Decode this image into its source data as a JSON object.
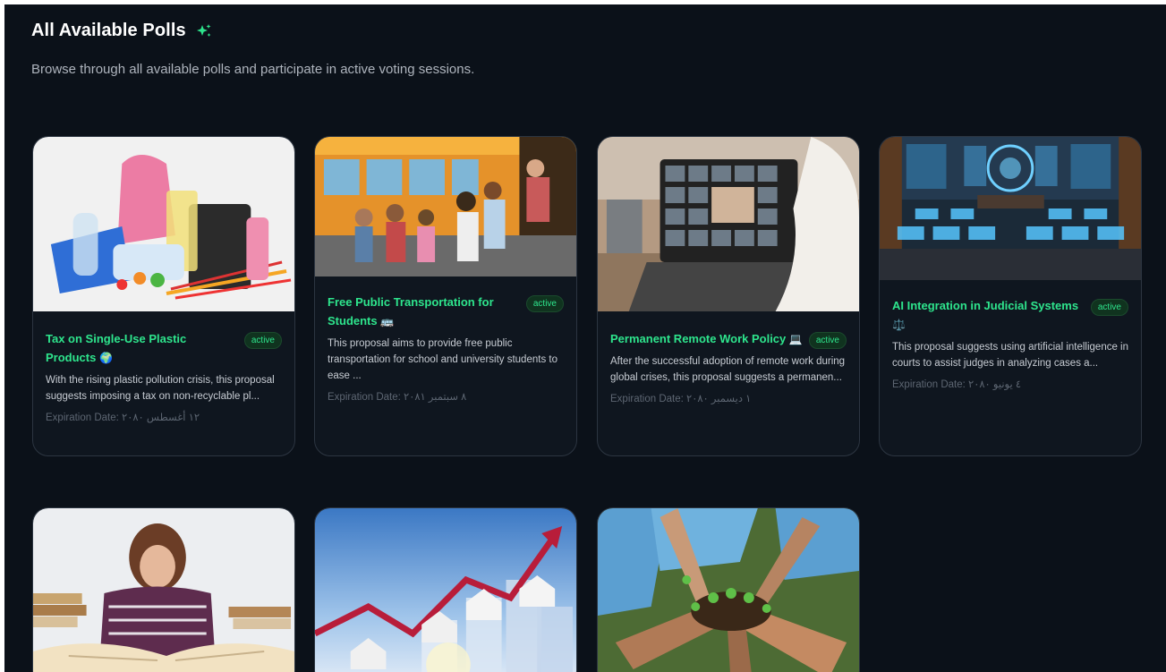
{
  "header": {
    "title": "All Available Polls",
    "subtitle": "Browse through all available polls and participate in active voting sessions."
  },
  "icons": {
    "title_icon": "sparkles-icon"
  },
  "colors": {
    "accent": "#2ee58d",
    "background": "#0b1119",
    "card": "#0f161f",
    "badge_bg": "#10331f"
  },
  "polls": [
    {
      "title": "Tax on Single-Use Plastic Products",
      "emoji": "🌍",
      "status": "active",
      "description": "With the rising plastic pollution crisis, this proposal suggests imposing a tax on non-recyclable pl...",
      "expiration": "Expiration Date: ١٢ أغسطس ٢٠٨٠",
      "image": "plastic-products-image"
    },
    {
      "title": "Free Public Transportation for Students",
      "emoji": "🚌",
      "status": "active",
      "description": "This proposal aims to provide free public transportation for school and university students to ease ...",
      "expiration": "Expiration Date: ٨ سبتمبر ٢٠٨١",
      "image": "school-bus-image"
    },
    {
      "title": "Permanent Remote Work Policy",
      "emoji": "💻",
      "status": "active",
      "description": "After the successful adoption of remote work during global crises, this proposal suggests a permanen...",
      "expiration": "Expiration Date: ١ ديسمبر ٢٠٨٠",
      "image": "video-call-laptop-image"
    },
    {
      "title": "AI Integration in Judicial Systems",
      "emoji": "⚖️",
      "status": "active",
      "description": "This proposal suggests using artificial intelligence in courts to assist judges in analyzing cases a...",
      "expiration": "Expiration Date: ٤ يونيو ٢٠٨٠",
      "image": "ai-courtroom-image"
    },
    {
      "image": "stressed-student-books-image"
    },
    {
      "image": "housing-market-growth-image"
    },
    {
      "image": "volunteers-plants-image"
    }
  ]
}
